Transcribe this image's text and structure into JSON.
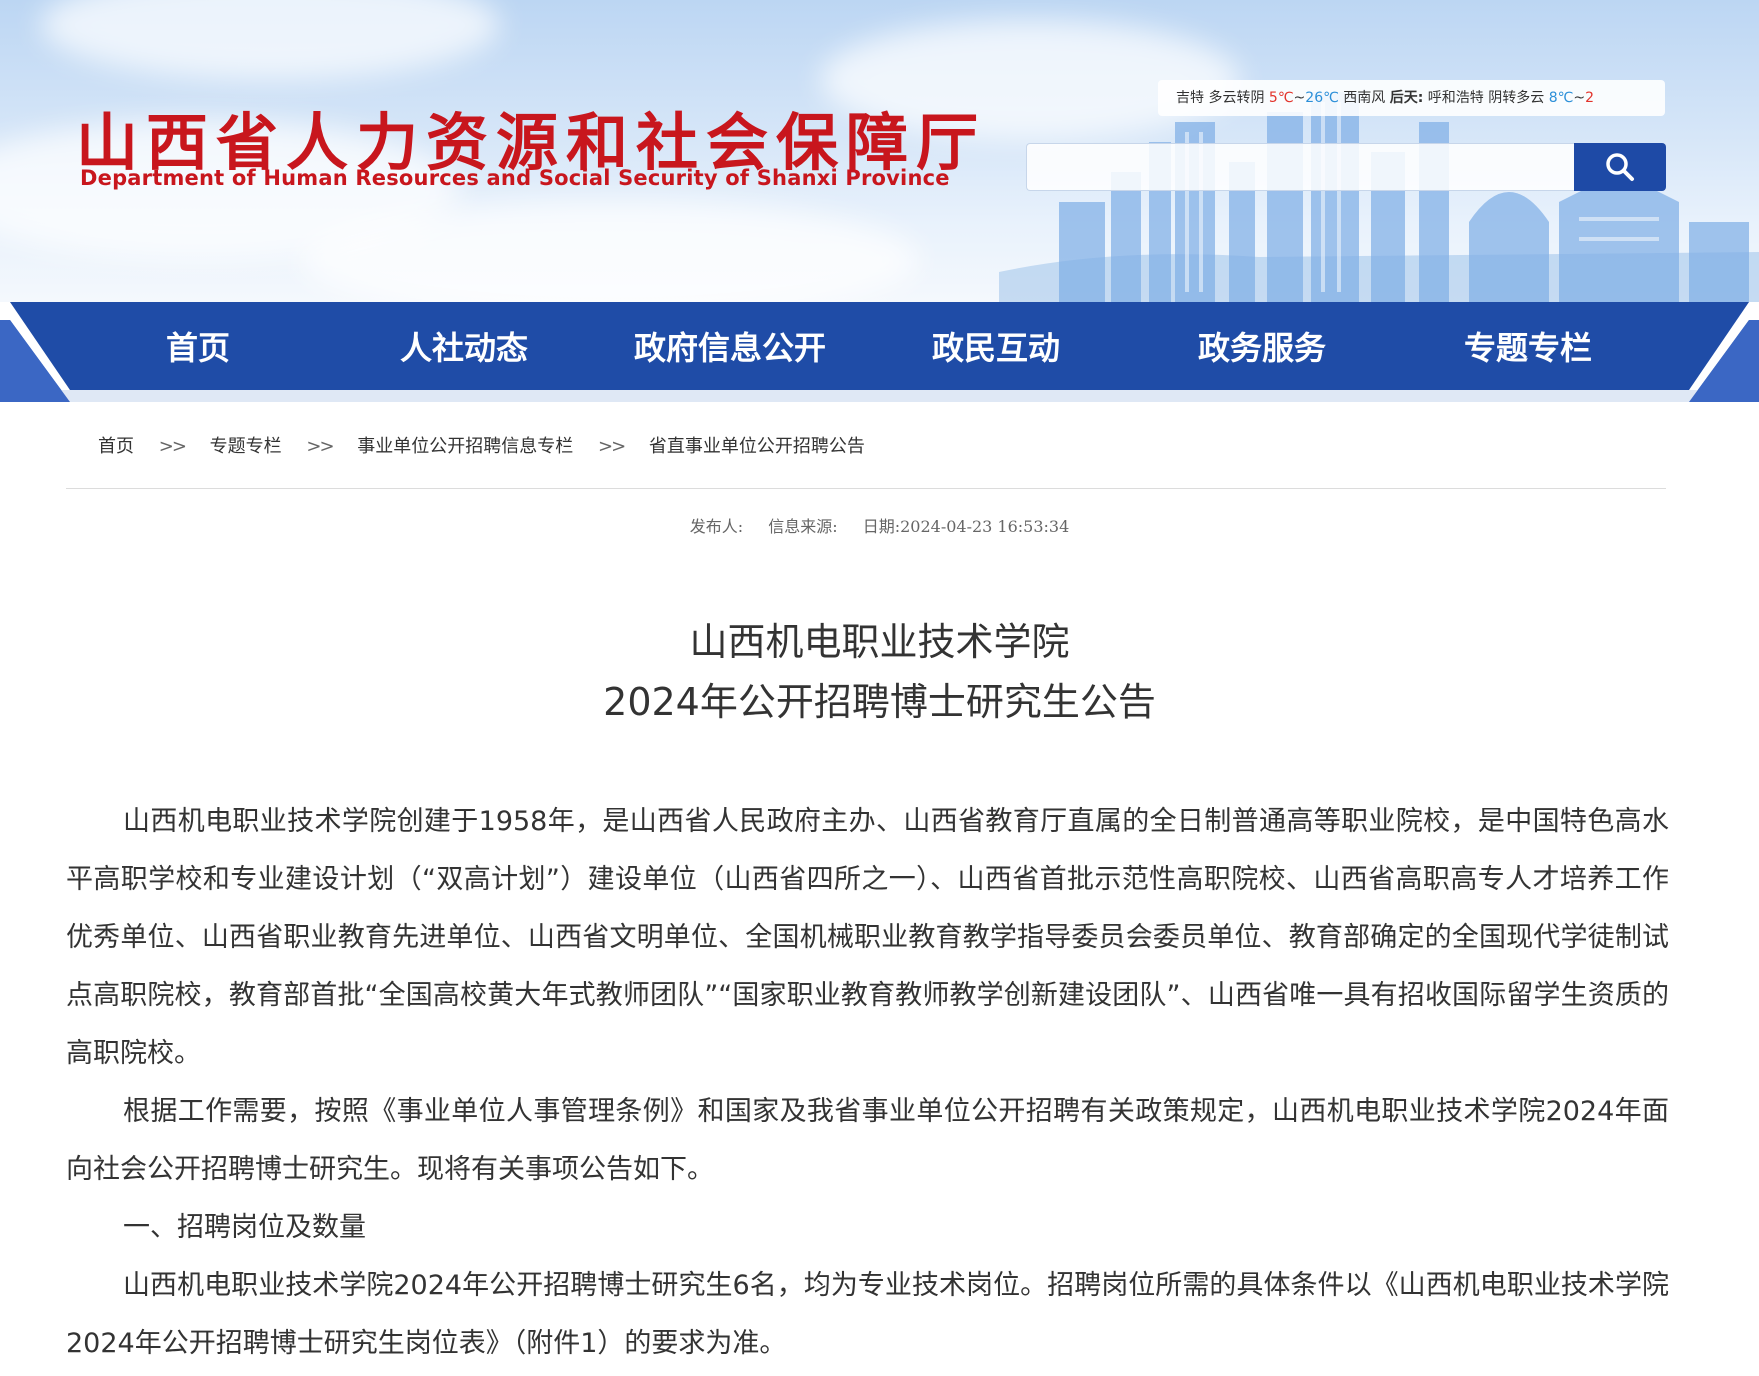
{
  "header": {
    "logo_cn": "山西省人力资源和社会保障厅",
    "logo_en": "Department of Human Resources and Social Security of Shanxi Province",
    "weather": {
      "city1": "吉特",
      "cond1": "多云转阴",
      "low1": "5℃",
      "tilde1": "~",
      "high1": "26℃",
      "wind1": "西南风",
      "day_label": "后天:",
      "city2": "呼和浩特",
      "cond2": "阴转多云",
      "low2": "8℃",
      "tilde2": "~",
      "high2": "2"
    },
    "search_placeholder": ""
  },
  "nav": {
    "items": [
      "首页",
      "人社动态",
      "政府信息公开",
      "政民互动",
      "政务服务",
      "专题专栏"
    ]
  },
  "breadcrumb": {
    "items": [
      "首页",
      "专题专栏",
      "事业单位公开招聘信息专栏",
      "省直事业单位公开招聘公告"
    ],
    "separator": ">>"
  },
  "meta": {
    "publisher": "发布人:",
    "source": "信息来源:",
    "date": "日期:2024-04-23 16:53:34"
  },
  "article": {
    "title_line1": "山西机电职业技术学院",
    "title_line2": "2024年公开招聘博士研究生公告",
    "paragraphs": [
      "山西机电职业技术学院创建于1958年，是山西省人民政府主办、山西省教育厅直属的全日制普通高等职业院校，是中国特色高水平高职学校和专业建设计划（“双高计划”）建设单位（山西省四所之一）、山西省首批示范性高职院校、山西省高职高专人才培养工作优秀单位、山西省职业教育先进单位、山西省文明单位、全国机械职业教育教学指导委员会委员单位、教育部确定的全国现代学徒制试点高职院校，教育部首批“全国高校黄大年式教师团队”“国家职业教育教师教学创新建设团队”、山西省唯一具有招收国际留学生资质的高职院校。",
      "根据工作需要，按照《事业单位人事管理条例》和国家及我省事业单位公开招聘有关政策规定，山西机电职业技术学院2024年面向社会公开招聘博士研究生。现将有关事项公告如下。",
      "一、招聘岗位及数量",
      "山西机电职业技术学院2024年公开招聘博士研究生6名，均为专业技术岗位。招聘岗位所需的具体条件以《山西机电职业技术学院2024年公开招聘博士研究生岗位表》（附件1）的要求为准。"
    ]
  },
  "colors": {
    "brand_red": "#c8161d",
    "nav_blue": "#1f4ca7",
    "search_blue": "#1e4aa6"
  }
}
